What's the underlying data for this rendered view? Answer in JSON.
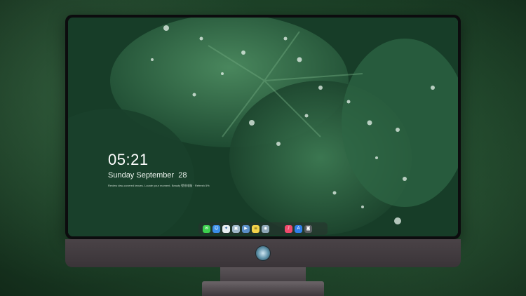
{
  "lock_screen": {
    "time": "05:21",
    "date": "Sunday September  28",
    "tagline": "Review dew-covered leaves. Locate your moment. Beauty 壁纸电脑 · Refresh 5%"
  },
  "dock": {
    "apps": [
      {
        "name": "messages",
        "color": "#3ccf4e",
        "glyph": "✉"
      },
      {
        "name": "finder",
        "color": "#3a8ee8",
        "glyph": "☺"
      },
      {
        "name": "safari",
        "color": "#e8eef2",
        "glyph": "✦"
      },
      {
        "name": "preview",
        "color": "#9fb7c9",
        "glyph": "▣"
      },
      {
        "name": "claquette",
        "color": "#5a8fc8",
        "glyph": "▶"
      },
      {
        "name": "notes",
        "color": "#f3d34a",
        "glyph": "≡"
      },
      {
        "name": "photos-viewer",
        "color": "#8fa8b8",
        "glyph": "◉"
      },
      {
        "name": "music",
        "color": "#f04a6c",
        "glyph": "♪"
      },
      {
        "name": "app-store",
        "color": "#2f7fe8",
        "glyph": "A"
      },
      {
        "name": "camera",
        "color": "#5a5e62",
        "glyph": "◙"
      }
    ]
  },
  "colors": {
    "monitor_frame": "#0c0c0e",
    "monitor_chin": "#4a4347",
    "wallpaper_green": "#245a3a"
  }
}
